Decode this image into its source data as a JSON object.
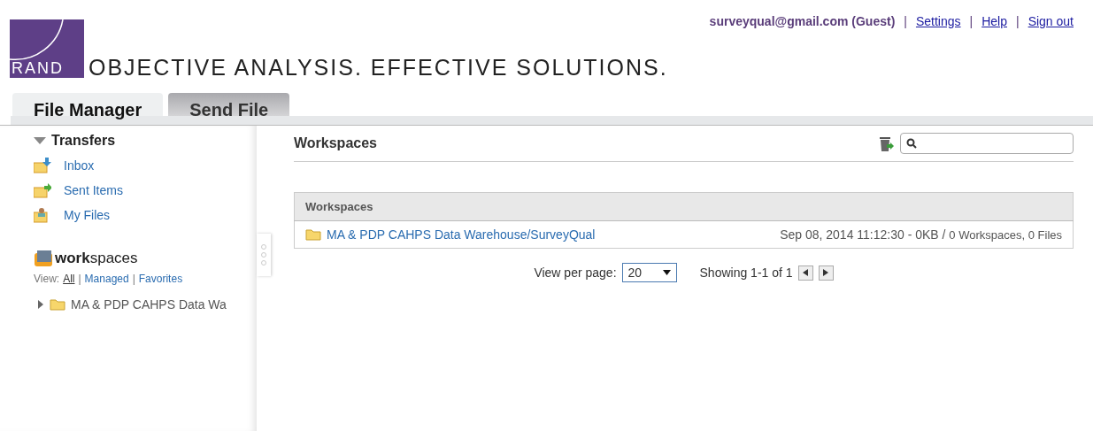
{
  "header": {
    "logo": "RAND",
    "tagline": "OBJECTIVE ANALYSIS. EFFECTIVE SOLUTIONS.",
    "user": "surveyqual@gmail.com (Guest)",
    "links": [
      {
        "sep": "|",
        "label": "Settings"
      },
      {
        "sep": "|",
        "label": "Help"
      },
      {
        "sep": "|",
        "label": "Sign out"
      }
    ]
  },
  "tabs": [
    {
      "label": "File Manager",
      "selected": true
    },
    {
      "label": "Send File",
      "selected": false
    }
  ],
  "sidebar": {
    "transfers": {
      "title": "Transfers",
      "expanded": true,
      "items": [
        {
          "label": "Inbox",
          "kind": "inbox"
        },
        {
          "label": "Sent Items",
          "kind": "sent"
        },
        {
          "label": "My Files",
          "kind": "myfiles"
        }
      ]
    },
    "workspaces": {
      "title": "**work**spaces",
      "view_label": "View:",
      "views": [
        {
          "label": "All",
          "selected": true
        },
        {
          "sep": "|",
          "label": "Managed",
          "selected": false
        },
        {
          "sep": "|",
          "label": "Favorites",
          "selected": false
        }
      ],
      "tree": [
        {
          "label": "MA & PDP CAHPS Data Wa",
          "expanded": false
        }
      ]
    }
  },
  "main": {
    "title": "Workspaces",
    "table": {
      "header": "Workspaces",
      "rows": [
        {
          "name": "MA & PDP CAHPS Data Warehouse/SurveyQual",
          "date": "Sep 08, 2014 11:12:30 - 0KB /",
          "counts": "0 Workspaces, 0 Files"
        }
      ]
    },
    "pagination": {
      "label": "View per page:",
      "per_page": "20",
      "showing": "Showing 1-1 of 1"
    }
  }
}
